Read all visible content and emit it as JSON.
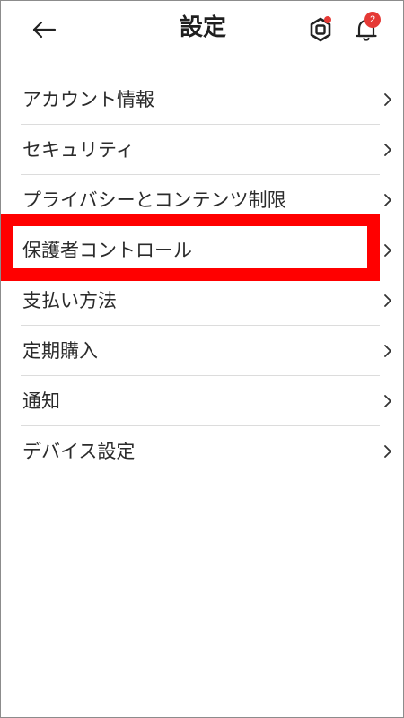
{
  "header": {
    "title": "設定",
    "back_icon": "back-arrow-icon",
    "shield_icon": "hexagon-nut-icon",
    "bell_icon": "bell-icon",
    "notification_count": "2"
  },
  "menu": {
    "items": [
      {
        "label": "アカウント情報"
      },
      {
        "label": "セキュリティ"
      },
      {
        "label": "プライバシーとコンテンツ制限"
      },
      {
        "label": "保護者コントロール"
      },
      {
        "label": "支払い方法"
      },
      {
        "label": "定期購入"
      },
      {
        "label": "通知"
      },
      {
        "label": "デバイス設定"
      }
    ]
  },
  "colors": {
    "highlight": "#ff0000",
    "badge": "#e53935",
    "divider": "#dcdcdc"
  }
}
